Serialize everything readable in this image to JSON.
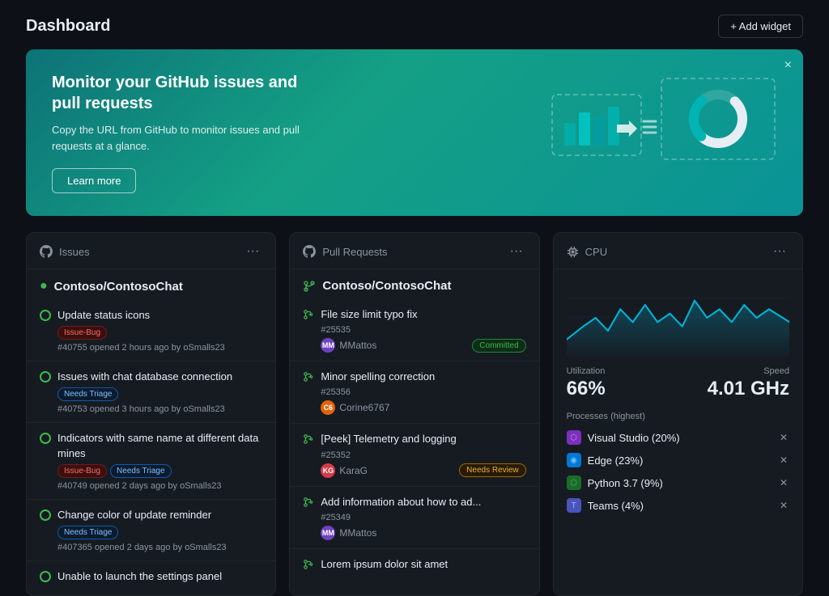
{
  "header": {
    "title": "Dashboard",
    "add_widget_label": "+ Add widget"
  },
  "banner": {
    "title": "Monitor your GitHub issues and pull requests",
    "description": "Copy the URL from GitHub to monitor issues and pull requests at a glance.",
    "learn_more_label": "Learn more",
    "close_label": "×"
  },
  "issues_widget": {
    "widget_label": "Issues",
    "repo_name": "Contoso/ContosoChat",
    "items": [
      {
        "title": "Update status icons",
        "tags": [
          "Issue-Bug"
        ],
        "meta": "#40755 opened 2 hours ago by oSmalls23"
      },
      {
        "title": "Issues with chat database connection",
        "tags": [
          "Needs Triage"
        ],
        "meta": "#40753 opened 3 hours ago by oSmalls23"
      },
      {
        "title": "Indicators with same name at different data mines",
        "tags": [
          "Issue-Bug",
          "Needs Triage"
        ],
        "meta": "#40749 opened 2 days ago by oSmalls23"
      },
      {
        "title": "Change color of update reminder",
        "tags": [
          "Needs Triage"
        ],
        "meta": "#407365 opened 2 days ago by oSmalls23"
      },
      {
        "title": "Unable to launch the settings panel",
        "tags": [],
        "meta": ""
      }
    ]
  },
  "pr_widget": {
    "widget_label": "Pull Requests",
    "repo_name": "Contoso/ContosoChat",
    "items": [
      {
        "title": "File size limit typo fix",
        "number": "#25535",
        "user": "MMattos",
        "badge": "Committed",
        "badge_type": "committed",
        "avatar_initials": "MM",
        "avatar_class": "av-mmattos"
      },
      {
        "title": "Minor spelling correction",
        "number": "#25356",
        "user": "Corine6767",
        "badge": "",
        "badge_type": "",
        "avatar_initials": "C6",
        "avatar_class": "av-corine"
      },
      {
        "title": "[Peek] Telemetry and logging",
        "number": "#25352",
        "user": "KaraG",
        "badge": "Needs Review",
        "badge_type": "needs-review",
        "avatar_initials": "KG",
        "avatar_class": "av-karag"
      },
      {
        "title": "Add information about how to ad...",
        "number": "#25349",
        "user": "MMattos",
        "badge": "",
        "badge_type": "",
        "avatar_initials": "MM",
        "avatar_class": "av-mmattos"
      },
      {
        "title": "Lorem ipsum dolor sit amet",
        "number": "",
        "user": "",
        "badge": "",
        "badge_type": "",
        "avatar_initials": "",
        "avatar_class": ""
      }
    ]
  },
  "cpu_widget": {
    "widget_label": "CPU",
    "utilization_label": "Utilization",
    "utilization_value": "66%",
    "speed_label": "Speed",
    "speed_value": "4.01 GHz",
    "processes_label": "Processes (highest)",
    "processes": [
      {
        "name": "Visual Studio (20%)",
        "icon_class": "vs-icon",
        "icon_char": "⬡"
      },
      {
        "name": "Edge (23%)",
        "icon_class": "edge-icon",
        "icon_char": "◉"
      },
      {
        "name": "Python 3.7 (9%)",
        "icon_class": "python-icon",
        "icon_char": "⬡"
      },
      {
        "name": "Teams (4%)",
        "icon_class": "teams-icon",
        "icon_char": "T"
      }
    ]
  }
}
